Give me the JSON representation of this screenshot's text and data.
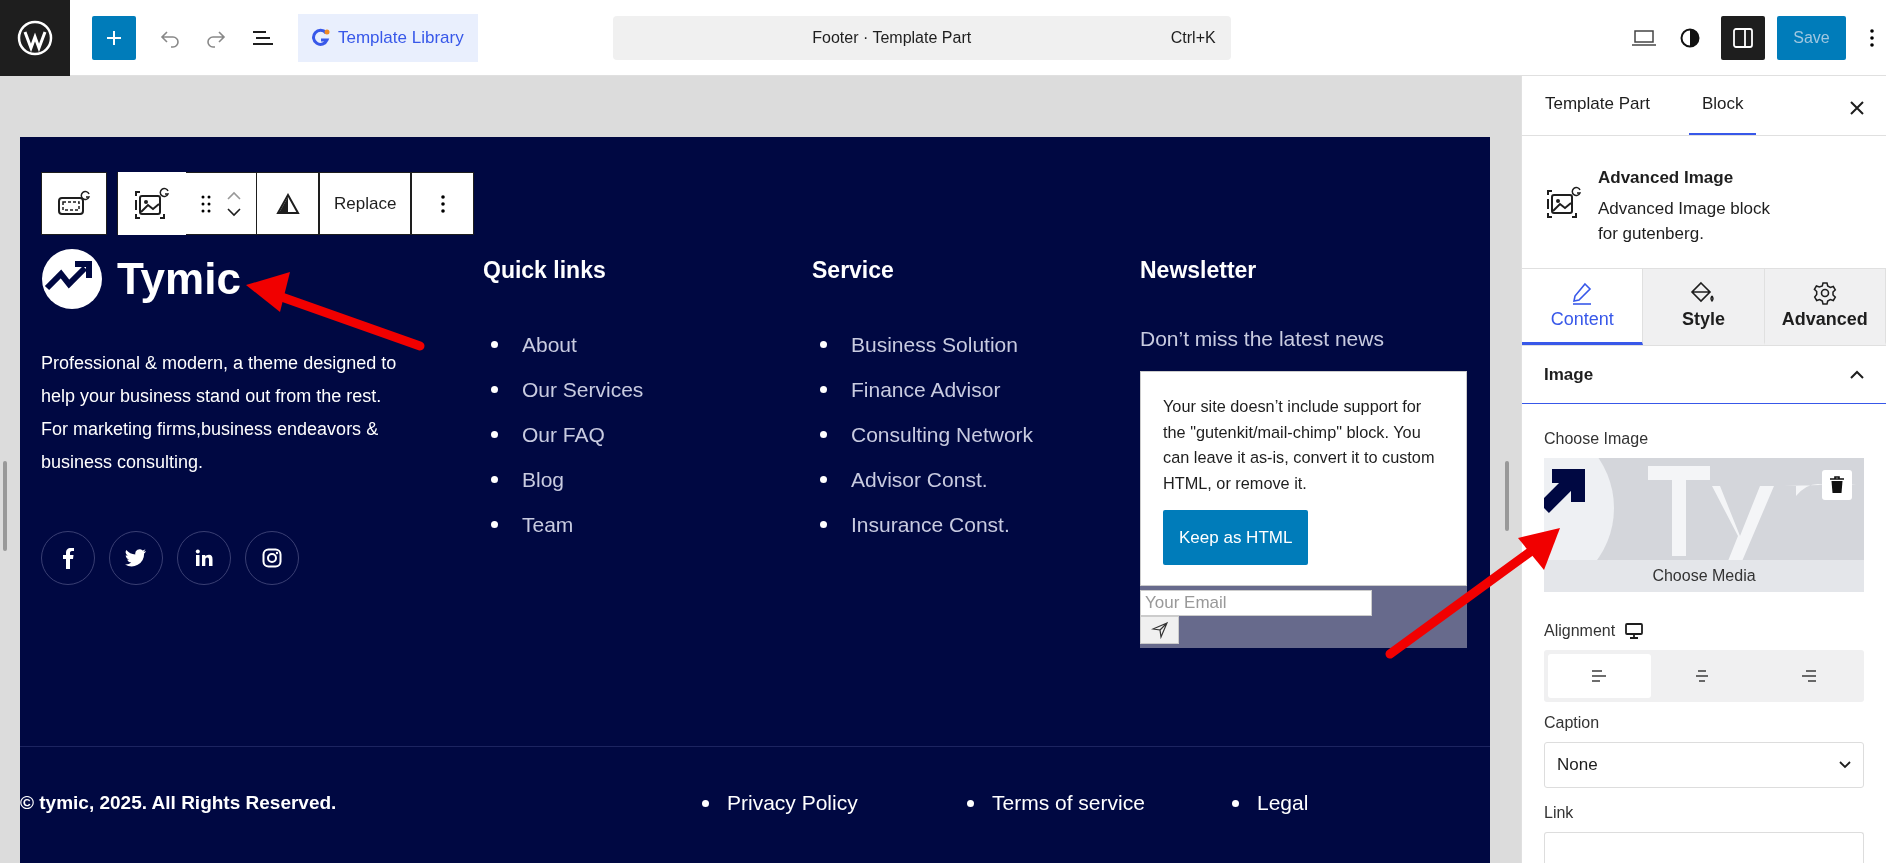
{
  "topbar": {
    "template_library": "Template Library",
    "command_title": "Footer · Template Part",
    "command_shortcut": "Ctrl+K",
    "sidebar_open": true,
    "save": "Save"
  },
  "block_toolbar": {
    "replace": "Replace"
  },
  "footer": {
    "logo": "Tymic",
    "about": "Professional & modern, a theme designed to help your business stand out from the rest. For marketing firms,business endeavors & business consulting.",
    "columns": [
      {
        "heading": "Quick links",
        "links": [
          "About",
          "Our Services",
          "Our FAQ",
          "Blog",
          "Team"
        ]
      },
      {
        "heading": "Service",
        "links": [
          "Business Solution",
          "Finance Advisor",
          "Consulting Network",
          "Advisor Const.",
          "Insurance Const."
        ]
      }
    ],
    "newsletter": {
      "heading": "Newsletter",
      "tagline": "Don’t miss the latest news",
      "notice": "Your site doesn’t include support for the \"gutenkit/mail-chimp\" block. You can leave it as-is, convert it to custom HTML, or remove it.",
      "keep_button": "Keep as HTML",
      "email_placeholder": "Your Email"
    },
    "copyright": "© tymic, 2025. All Rights Reserved.",
    "legal_links": [
      "Privacy Policy",
      "Terms of service",
      "Legal"
    ]
  },
  "sidebar": {
    "tabs": [
      {
        "label": "Template Part",
        "selected": false
      },
      {
        "label": "Block",
        "selected": true
      }
    ],
    "block": {
      "title": "Advanced Image",
      "description": "Advanced Image block for gutenberg."
    },
    "panel_tabs": [
      {
        "kind": "edit",
        "label": "Content",
        "selected": true
      },
      {
        "kind": "style",
        "label": "Style",
        "selected": false
      },
      {
        "kind": "settings",
        "label": "Advanced",
        "selected": false
      }
    ],
    "section": {
      "title": "Image",
      "expanded": true
    },
    "choose_image": "Choose Image",
    "choose_media": "Choose Media",
    "alignment": {
      "label": "Alignment",
      "options": [
        {
          "kind": "left",
          "selected": true
        },
        {
          "kind": "center",
          "selected": false
        },
        {
          "kind": "right",
          "selected": false
        }
      ]
    },
    "caption": {
      "label": "Caption",
      "value": "None"
    },
    "link": {
      "label": "Link"
    }
  }
}
